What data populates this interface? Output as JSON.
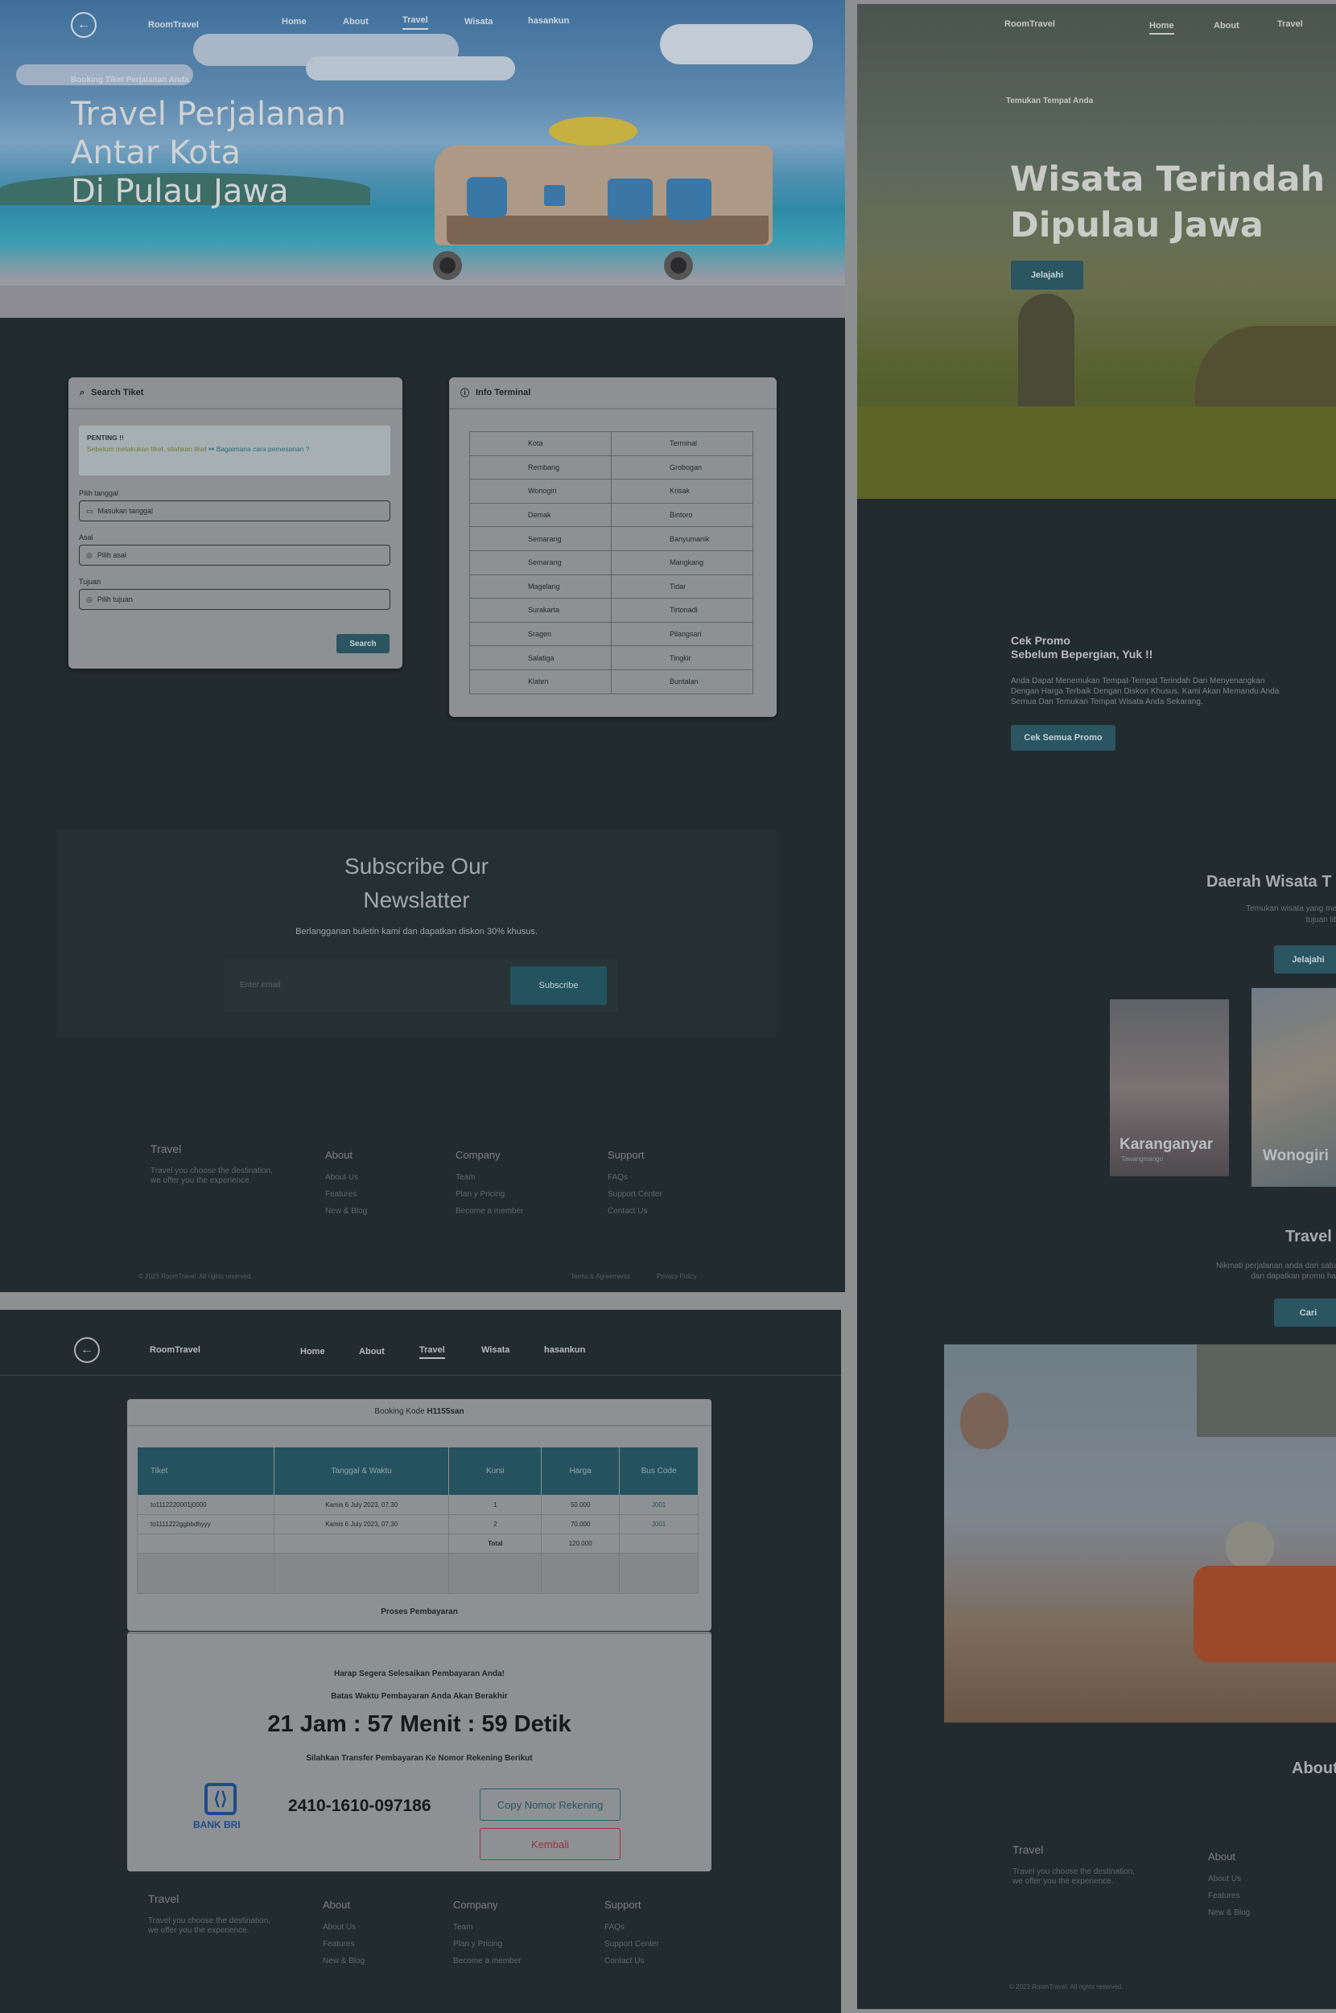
{
  "panel_a": {
    "nav": {
      "brand": "RoomTravel",
      "links": [
        "Home",
        "About",
        "Travel",
        "Wisata",
        "hasankun"
      ],
      "active": "Travel"
    },
    "hero": {
      "kicker": "Booking Tiket Perjalanan Anda",
      "title_lines": [
        "Travel  Perjalanan",
        "Antar  Kota",
        "Di Pulau Jawa"
      ]
    },
    "search": {
      "title": "Search Tiket",
      "notice_title": "PENTING !!",
      "notice_text": "Sebelum melakukan tiket, silahkan lihat",
      "notice_link": "Bagaimana cara pemesanan ?",
      "date_label": "Pilih tanggal",
      "date_placeholder": "Masukan tanggal",
      "origin_label": "Asal",
      "origin_placeholder": "Pilih asal",
      "dest_label": "Tujuan",
      "dest_placeholder": "Pilih tujuan",
      "button": "Search"
    },
    "terminal": {
      "title": "Info Terminal",
      "headers": [
        "Kota",
        "Terminal"
      ],
      "rows": [
        [
          "Rembang",
          "Grobogan"
        ],
        [
          "Wonogiri",
          "Krisak"
        ],
        [
          "Demak",
          "Bintoro"
        ],
        [
          "Semarang",
          "Banyumanik"
        ],
        [
          "Semarang",
          "Mangkang"
        ],
        [
          "Magelang",
          "Tidar"
        ],
        [
          "Surakarta",
          "Tirtonadi"
        ],
        [
          "Sragen",
          "Pilangsari"
        ],
        [
          "Salatiga",
          "Tingkir"
        ],
        [
          "Klaten",
          "Buntalan"
        ]
      ]
    },
    "newsletter": {
      "title_lines": [
        "Subscribe Our",
        "Newslatter"
      ],
      "subtitle": "Berlangganan buletin kami dan dapatkan diskon 30% khusus.",
      "placeholder": "Enter email",
      "button": "Subscribe"
    },
    "footer": {
      "brand": "Travel",
      "tagline": "Travel you choose the destination, we offer you the experience.",
      "cols": [
        {
          "title": "About",
          "items": [
            "About Us",
            "Features",
            "New & Blog"
          ]
        },
        {
          "title": "Company",
          "items": [
            "Team",
            "Plan y Pricing",
            "Become a member"
          ]
        },
        {
          "title": "Support",
          "items": [
            "FAQs",
            "Support Center",
            "Contact Us"
          ]
        }
      ],
      "copyright": "© 2023 RoomTravel. All rights reserved.",
      "legal": [
        "Terms & Agreements",
        "Privacy Policy"
      ]
    }
  },
  "panel_b": {
    "nav": {
      "brand": "RoomTravel",
      "links": [
        "Home",
        "About",
        "Travel"
      ],
      "active": "Home"
    },
    "hero": {
      "kicker": "Temukan Tempat Anda",
      "title_lines": [
        "Wisata Terindah",
        "Dipulau Jawa"
      ],
      "button": "Jelajahi"
    },
    "promo": {
      "title_lines": [
        "Cek Promo",
        "Sebelum Bepergian, Yuk !!"
      ],
      "text": "Anda Dapat Menemukan Tempat-Tempat Terindah Dan Menyenangkan Dengan Harga Terbaik Dengan Diskon Khusus. Kami Akan Memandu Anda Semua Dan Temukan Tempat Wisata Anda Sekarang.",
      "button": "Cek Semua Promo"
    },
    "daerah": {
      "title": "Daerah Wisata T",
      "text_lines": [
        "Temukan wisata yang menarik d",
        "tujuan liburan a"
      ],
      "button": "Jelajahi",
      "cards": [
        {
          "name": "Karanganyar",
          "sub": "Tawangmangu"
        },
        {
          "name": "Wonogiri",
          "sub": ""
        }
      ]
    },
    "travel": {
      "title": "Travel",
      "text_lines": [
        "Nikmati perjalanan anda dari satu",
        "dan dapatkan promo ha"
      ],
      "button": "Cari"
    },
    "about": {
      "title": "About"
    },
    "footer": {
      "brand": "Travel",
      "tagline": "Travel you choose the destination, we offer you the experience.",
      "col": {
        "title": "About",
        "items": [
          "About Us",
          "Features",
          "New & Blog"
        ]
      },
      "copyright": "© 2023 RoomTravel. All rights reserved."
    }
  },
  "panel_c": {
    "nav": {
      "brand": "RoomTravel",
      "links": [
        "Home",
        "About",
        "Travel",
        "Wisata",
        "hasankun"
      ],
      "active": "Travel"
    },
    "booking": {
      "code_label": "Booking Kode",
      "code": "H1155san",
      "headers": [
        "Tiket",
        "Tanggal & Waktu",
        "Kursi",
        "Harga",
        "Bus Code"
      ],
      "rows": [
        [
          "to1112220001j0000",
          "Kamis 6 July 2023, 07.30",
          "1",
          "50.000",
          "J001"
        ],
        [
          "to1111222ggbbdhyyy",
          "Kamis 6 July 2023, 07.30",
          "2",
          "70.000",
          "J001"
        ]
      ],
      "total_label": "Total",
      "total": "120.000"
    },
    "payment": {
      "title": "Proses Pembayaran",
      "line1": "Harap Segera Selesaikan Pembayaran Anda!",
      "line2": "Batas Waktu Pembayaran Anda Akan Berakhir",
      "countdown": "21 Jam : 57 Menit : 59 Detik",
      "line3": "Silahkan Transfer Pembayaran Ke Nomor Rekening Berikut",
      "bank": "BANK BRI",
      "account": "2410-1610-097186",
      "copy_button": "Copy Nomor Rekening",
      "back_button": "Kembali"
    },
    "footer": {
      "brand": "Travel",
      "tagline": "Travel you choose the destination, we offer you the experience.",
      "cols": [
        {
          "title": "About",
          "items": [
            "About Us",
            "Features",
            "New & Blog"
          ]
        },
        {
          "title": "Company",
          "items": [
            "Team",
            "Plan y Pricing",
            "Become a member"
          ]
        },
        {
          "title": "Support",
          "items": [
            "FAQs",
            "Support Center",
            "Contact Us"
          ]
        }
      ]
    }
  }
}
